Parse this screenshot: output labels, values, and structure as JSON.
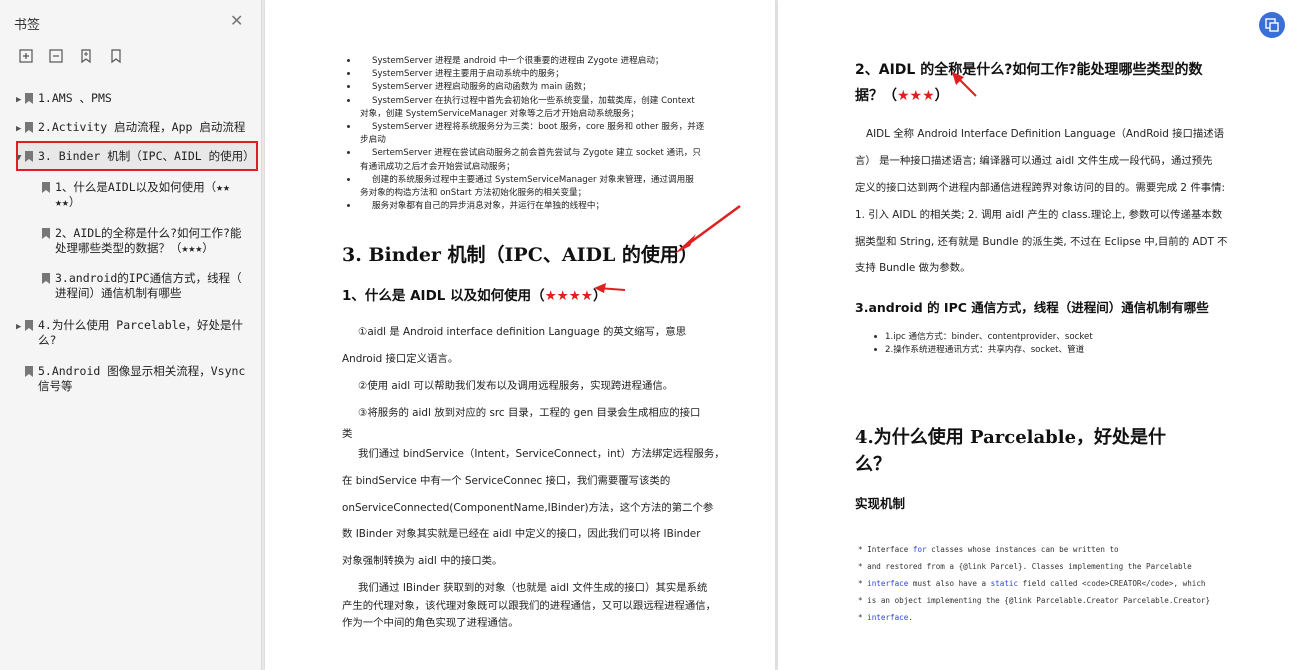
{
  "sidebar": {
    "title": "书签",
    "close_icon": "close-icon",
    "tools": [
      "expand-bookmark-icon",
      "collapse-bookmark-icon",
      "add-bookmark-icon",
      "bookmark-icon"
    ],
    "items": [
      {
        "label": "1.AMS 、PMS"
      },
      {
        "label": "2.Activity 启动流程，App 启动流程"
      },
      {
        "label": "3. Binder 机制（IPC、AIDL 的使用）"
      },
      {
        "label_l1": "1、什么是AIDL以及如何使用（★★",
        "label_l2": "★★）"
      },
      {
        "label_l1": "2、AIDL的全称是什么?如何工作?能",
        "label_l2": "处理哪些类型的数据？（★★★）"
      },
      {
        "label_l1": "3.android的IPC通信方式，线程（",
        "label_l2": "进程间）通信机制有哪些"
      },
      {
        "label_l1": "4.为什么使用 Parcelable，好处是什",
        "label_l2": "么?"
      },
      {
        "label_l1": "5.Android 图像显示相关流程，Vsync",
        "label_l2": "信号等"
      }
    ]
  },
  "page1": {
    "bullets": [
      "SystemServer 进程是 android 中一个很重要的进程由 Zygote 进程启动；",
      "SystemServer 进程主要用于启动系统中的服务；",
      "SystemServer 进程启动服务的启动函数为 main 函数；",
      "SystemServer 在执行过程中首先会初始化一些系统变量，加载类库，创建 Context",
      "对象，创建 SystemServiceManager 对象等之后才开始启动系统服务；",
      "SystemServer 进程将系统服务分为三类：boot 服务，core 服务和 other 服务，并逐",
      "步启动",
      "SertemServer 进程在尝试启动服务之前会首先尝试与 Zygote 建立 socket 通讯，只",
      "有通讯成功之后才会开始尝试启动服务；",
      "创建的系统服务过程中主要通过 SystemServiceManager 对象来管理，通过调用服",
      "务对象的构造方法和 onStart 方法初始化服务的相关变量；",
      "服务对象都有自己的异步消息对象，并运行在单独的线程中；"
    ],
    "heading": "3. Binder 机制（IPC、AIDL 的使用）",
    "sub_heading": "1、什么是 AIDL 以及如何使用（",
    "sub_stars": "★★★★",
    "sub_close": "）",
    "p1a": "①aidl 是 Android interface definition Language 的英文缩写，意思",
    "p1b": "Android 接口定义语言。",
    "p2": "②使用 aidl 可以帮助我们发布以及调用远程服务，实现跨进程通信。",
    "p3a": "③将服务的 aidl 放到对应的 src 目录，工程的 gen 目录会生成相应的接口",
    "p3b": "类",
    "p4": [
      "我们通过 bindService（Intent，ServiceConnect，int）方法绑定远程服务，",
      "在 bindService 中有一个 ServiceConnec 接口，我们需要覆写该类的",
      "onServiceConnected(ComponentName,IBinder)方法，这个方法的第二个参",
      "数 IBinder 对象其实就是已经在 aidl 中定义的接口，因此我们可以将 IBinder",
      "对象强制转换为 aidl 中的接口类。"
    ],
    "p5": [
      "我们通过 IBinder 获取到的对象（也就是 aidl 文件生成的接口）其实是系统",
      "产生的代理对象，该代理对象既可以跟我们的进程通信，又可以跟远程进程通信，",
      "作为一个中间的角色实现了进程通信。"
    ]
  },
  "page2": {
    "h1a": "2、AIDL 的全称是什么?如何工作?能处理哪些类型的数",
    "h1b": "据？（",
    "h1_stars": "★★★",
    "h1_close": "）",
    "para": [
      "AIDL 全称 Android Interface Definition Language（AndRoid 接口描述语",
      "言） 是一种接口描述语言; 编译器可以通过 aidl 文件生成一段代码，通过预先",
      "定义的接口达到两个进程内部通信进程跨界对象访问的目的。需要完成 2 件事情:",
      "1. 引入 AIDL 的相关类; 2. 调用 aidl 产生的 class.理论上, 参数可以传递基本数",
      "据类型和 String, 还有就是 Bundle 的派生类, 不过在 Eclipse 中,目前的 ADT 不",
      "支持 Bundle 做为参数。"
    ],
    "h2": "3.android 的 IPC 通信方式，线程（进程间）通信机制有哪些",
    "ipc": [
      "1.ipc 通信方式：binder、contentprovider、socket",
      "2.操作系统进程通讯方式：共享内存、socket、管道"
    ],
    "h3a": "4.为什么使用 Parcelable，好处是什",
    "h3b": "么？",
    "h4": "实现机制",
    "code": {
      "l1a": "* Interface ",
      "l1kw": "for",
      "l1b": " classes whose instances can be written to",
      "l2": "* and restored from a {@link Parcel}.  Classes implementing the Parcelable",
      "l3a": "* ",
      "l3kw": "interface",
      "l3b": " must also have a ",
      "l3kw2": "static",
      "l3c": " field called <code>CREATOR</code>, which",
      "l4": "* is an object implementing the {@link Parcelable.Creator Parcelable.Creator}",
      "l5a": "* ",
      "l5kw": "interface",
      "l5b": "."
    }
  },
  "colors": {
    "accent_red": "#e02020",
    "fab_blue": "#3a6fd8",
    "keyword_blue": "#2a45d8"
  }
}
